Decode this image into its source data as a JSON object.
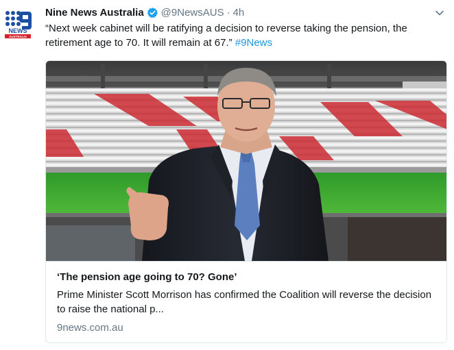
{
  "tweet": {
    "display_name": "Nine News Australia",
    "handle": "@9NewsAUS",
    "separator": "·",
    "time": "4h",
    "text_main": "“Next week cabinet will be ratifying a decision to reverse taking the pension, the retirement age to 70. It will remain at 67.”",
    "hashtag": "#9News",
    "avatar_logo_text": "NEWS",
    "avatar_logo_sub": "AUSTRALIA"
  },
  "card": {
    "title": "‘The pension age going to 70? Gone’",
    "description": "Prime Minister Scott Morrison has confirmed the Coalition will reverse the decision to raise the national p...",
    "domain": "9news.com.au"
  },
  "colors": {
    "text": "#14171a",
    "secondary": "#657786",
    "link": "#1b95e0",
    "verified": "#1da1f2",
    "avatar_blue": "#1c4fa3",
    "avatar_red": "#d8202a",
    "border": "#e1e8ed"
  },
  "icons": {
    "verified": "verified-badge-icon",
    "caret": "chevron-down-icon"
  }
}
